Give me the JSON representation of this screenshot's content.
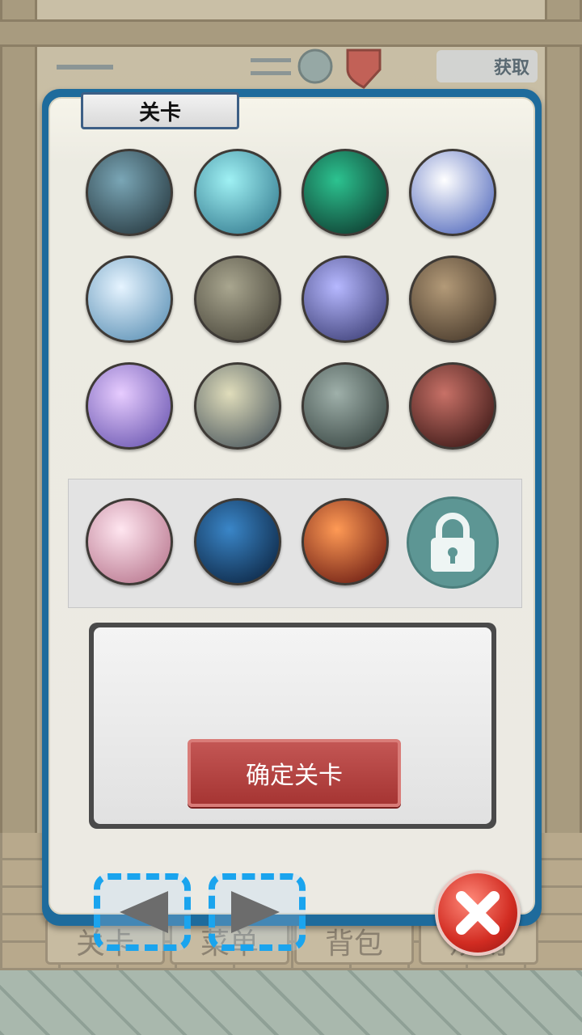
{
  "panel": {
    "title": "关卡"
  },
  "stages": [
    {
      "name": "misty-swamp",
      "g1": "#7aa6b6",
      "g2": "#1e2d33"
    },
    {
      "name": "ice-cave",
      "g1": "#9ff1f4",
      "g2": "#2a6f85"
    },
    {
      "name": "green-vortex",
      "g1": "#2cc390",
      "g2": "#0b2b24"
    },
    {
      "name": "waterfall",
      "g1": "#ffffff",
      "g2": "#3f59b5"
    },
    {
      "name": "ice-castle",
      "g1": "#e6f4ff",
      "g2": "#4d86ad"
    },
    {
      "name": "stone-hall",
      "g1": "#a9a68f",
      "g2": "#3e3b31"
    },
    {
      "name": "blue-corridor",
      "g1": "#b6b8ff",
      "g2": "#2f3166"
    },
    {
      "name": "library",
      "g1": "#b39a78",
      "g2": "#3b2e22"
    },
    {
      "name": "crystal-hall",
      "g1": "#e7ccff",
      "g2": "#5d4aa8"
    },
    {
      "name": "palace-gate",
      "g1": "#e0ddbb",
      "g2": "#3b4954"
    },
    {
      "name": "ruined-room",
      "g1": "#9fb0aa",
      "g2": "#2d3a37"
    },
    {
      "name": "red-door",
      "g1": "#c87167",
      "g2": "#2b0e0d"
    }
  ],
  "special_stages": [
    {
      "name": "rose-chamber",
      "g1": "#ffe6f0",
      "g2": "#b06a83"
    },
    {
      "name": "deep-blue-temple",
      "g1": "#3a86c8",
      "g2": "#071a33"
    },
    {
      "name": "fire-chains",
      "g1": "#ff9a55",
      "g2": "#5a0d0b"
    }
  ],
  "locked_stage_icon": "lock-icon",
  "description": {
    "text": ""
  },
  "confirm_button": {
    "label": "确定关卡"
  },
  "navigation": {
    "prev_icon": "left-arrow-icon",
    "next_icon": "right-arrow-icon",
    "close_icon": "close-icon"
  },
  "background": {
    "bottom_tabs": [
      "关卡",
      "菜单",
      "背包",
      "规则"
    ],
    "top_badge": "获取"
  }
}
